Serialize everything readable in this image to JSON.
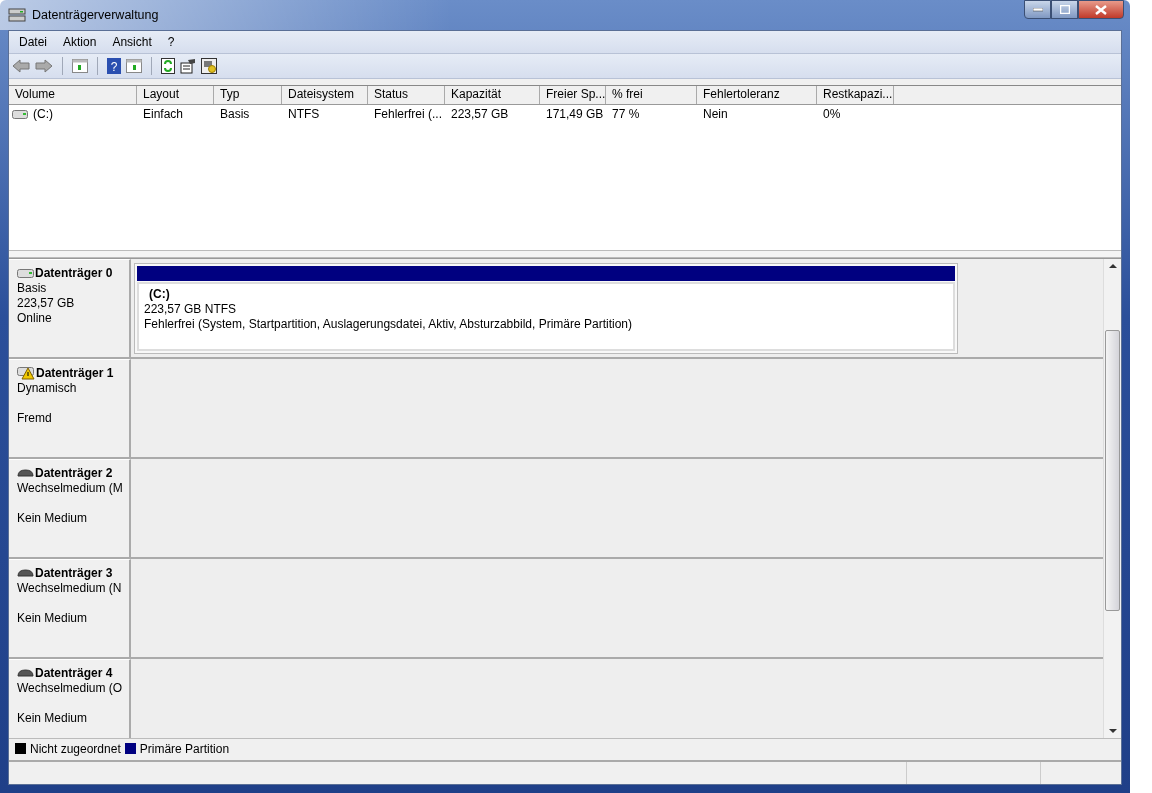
{
  "window": {
    "title": "Datenträgerverwaltung"
  },
  "menu": [
    "Datei",
    "Aktion",
    "Ansicht",
    "?"
  ],
  "toolbar": {
    "help_glyph": "?"
  },
  "table": {
    "columns": [
      "Volume",
      "Layout",
      "Typ",
      "Dateisystem",
      "Status",
      "Kapazität",
      "Freier Sp...",
      "% frei",
      "Fehlertoleranz",
      "Restkapazi..."
    ],
    "rows": [
      {
        "cells": [
          "(C:)",
          "Einfach",
          "Basis",
          "NTFS",
          "Fehlerfrei (...",
          "223,57 GB",
          "171,49 GB",
          "77 %",
          "Nein",
          "0%"
        ]
      }
    ]
  },
  "disks": [
    {
      "kind": "hdd",
      "name": "Datenträger 0",
      "type": "Basis",
      "size": "223,57 GB",
      "state": "Online",
      "partitions": [
        {
          "name": "(C:)",
          "size": "223,57 GB NTFS",
          "status": "Fehlerfrei (System, Startpartition, Auslagerungsdatei, Aktiv, Absturzabbild, Primäre Partition)",
          "color": "#000080"
        }
      ]
    },
    {
      "kind": "hdd-warning",
      "name": "Datenträger 1",
      "type": "Dynamisch",
      "state": "Fremd"
    },
    {
      "kind": "removable",
      "name": "Datenträger 2",
      "type": "Wechselmedium (M",
      "state": "Kein Medium"
    },
    {
      "kind": "removable",
      "name": "Datenträger 3",
      "type": "Wechselmedium (N",
      "state": "Kein Medium"
    },
    {
      "kind": "removable",
      "name": "Datenträger 4",
      "type": "Wechselmedium (O",
      "state": "Kein Medium"
    }
  ],
  "legend": [
    {
      "label": "Nicht zugeordnet",
      "color": "#000000"
    },
    {
      "label": "Primäre Partition",
      "color": "#000080"
    }
  ]
}
